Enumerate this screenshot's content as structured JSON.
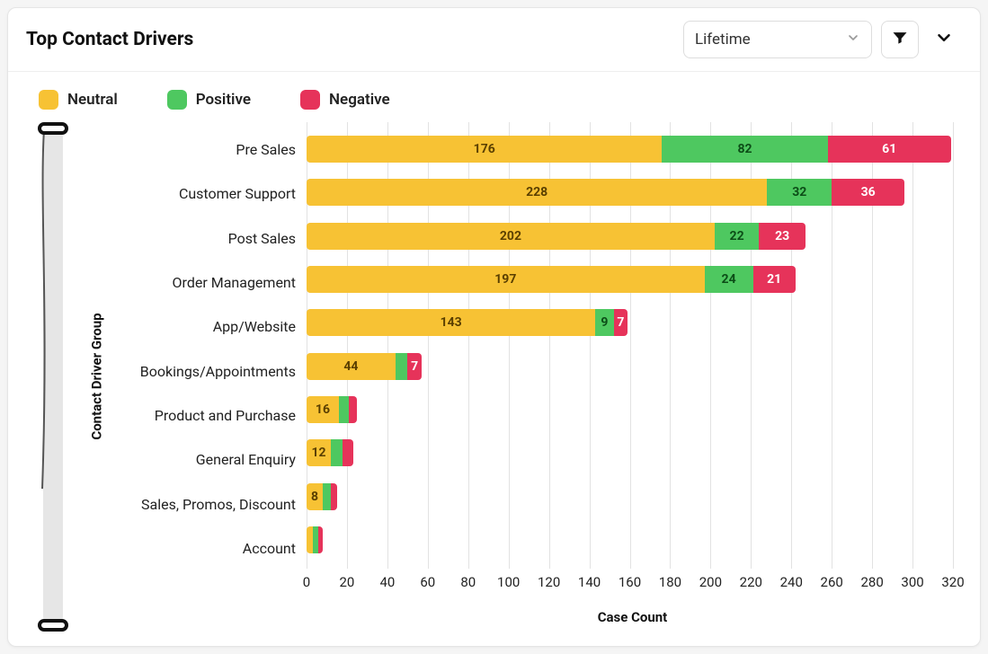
{
  "header": {
    "title": "Top Contact Drivers",
    "dropdown_value": "Lifetime"
  },
  "legend": [
    {
      "label": "Neutral",
      "color": "#f7c234"
    },
    {
      "label": "Positive",
      "color": "#4ec860"
    },
    {
      "label": "Negative",
      "color": "#e6335a"
    }
  ],
  "axes": {
    "ylabel": "Contact Driver Group",
    "xlabel": "Case Count",
    "ticks": [
      0,
      20,
      40,
      60,
      80,
      100,
      120,
      140,
      160,
      180,
      200,
      220,
      240,
      260,
      280,
      300,
      320
    ]
  },
  "chart_data": {
    "type": "bar",
    "orientation": "horizontal",
    "stacked": true,
    "title": "Top Contact Drivers",
    "ylabel": "Contact Driver Group",
    "xlabel": "Case Count",
    "xlim": [
      0,
      320
    ],
    "categories": [
      "Pre Sales",
      "Customer Support",
      "Post Sales",
      "Order Management",
      "App/Website",
      "Bookings/Appointments",
      "Product and Purchase",
      "General Enquiry",
      "Sales, Promos, Discount",
      "Account"
    ],
    "series": [
      {
        "name": "Neutral",
        "color": "#f7c234",
        "values": [
          176,
          228,
          202,
          197,
          143,
          44,
          16,
          12,
          8,
          3
        ]
      },
      {
        "name": "Positive",
        "color": "#4ec860",
        "values": [
          82,
          32,
          22,
          24,
          9,
          6,
          5,
          6,
          4,
          3
        ]
      },
      {
        "name": "Negative",
        "color": "#e6335a",
        "values": [
          61,
          36,
          23,
          21,
          7,
          7,
          4,
          5,
          3,
          2
        ]
      }
    ],
    "labels": [
      [
        "176",
        "82",
        "61"
      ],
      [
        "228",
        "32",
        "36"
      ],
      [
        "202",
        "22",
        "23"
      ],
      [
        "197",
        "24",
        "21"
      ],
      [
        "143",
        "9",
        "7"
      ],
      [
        "44",
        "",
        "7"
      ],
      [
        "16",
        "",
        ""
      ],
      [
        "12",
        "",
        ""
      ],
      [
        "8",
        "",
        ""
      ],
      [
        "",
        "",
        ""
      ]
    ]
  }
}
